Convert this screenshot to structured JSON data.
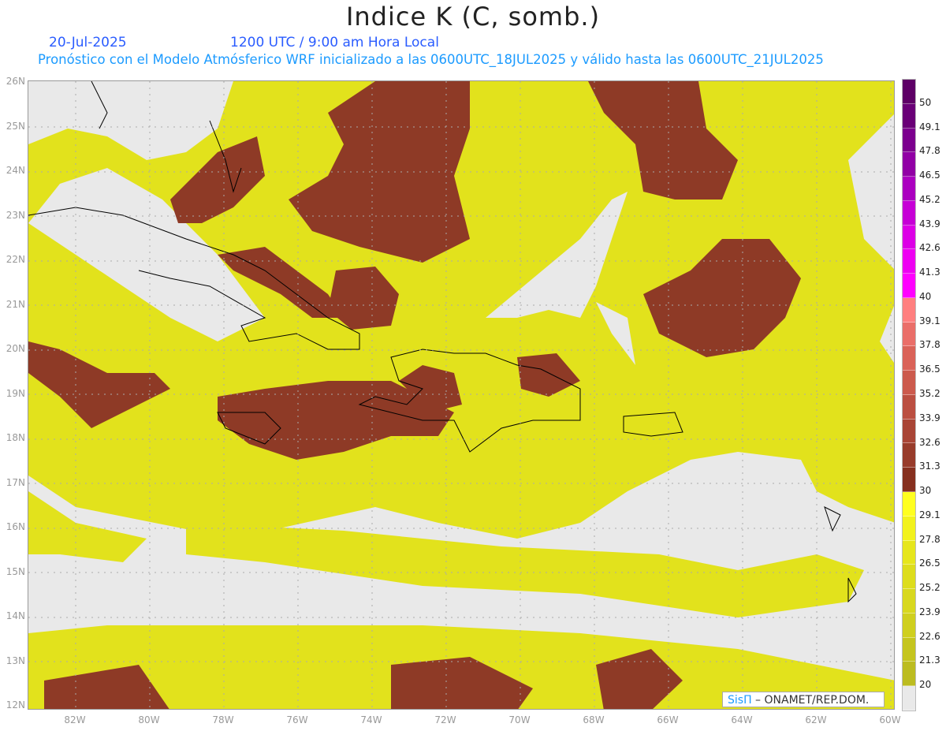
{
  "header": {
    "title": "Indice K (C, somb.)",
    "date": "20-Jul-2025",
    "time": "1200 UTC / 9:00 am Hora Local",
    "subtitle": "Pronóstico con el Modelo Atmósferico WRF inicializado a las 0600UTC_18JUL2025 y válido hasta las  0600UTC_21JUL2025"
  },
  "lat_labels": [
    "26N",
    "25N",
    "24N",
    "23N",
    "22N",
    "21N",
    "20N",
    "19N",
    "18N",
    "17N",
    "16N",
    "15N",
    "14N",
    "13N",
    "12N"
  ],
  "lon_labels": [
    "82W",
    "80W",
    "78W",
    "76W",
    "74W",
    "72W",
    "70W",
    "68W",
    "66W",
    "64W",
    "62W",
    "60W"
  ],
  "colorbar": {
    "labels": [
      "50",
      "49.1",
      "47.8",
      "46.5",
      "45.2",
      "43.9",
      "42.6",
      "41.3",
      "40",
      "39.1",
      "37.8",
      "36.5",
      "35.2",
      "33.9",
      "32.6",
      "31.3",
      "30",
      "29.1",
      "27.8",
      "26.5",
      "25.2",
      "23.9",
      "22.6",
      "21.3",
      "20"
    ],
    "colors": [
      "#5e0066",
      "#6a0077",
      "#7c008e",
      "#9100a5",
      "#ab00c0",
      "#c600d6",
      "#dc00e6",
      "#ee00f2",
      "#ff00ff",
      "#ff7f7f",
      "#ea6e69",
      "#da6258",
      "#cc5a4d",
      "#bb4f41",
      "#a94536",
      "#983c2b",
      "#86301f",
      "#ffff20",
      "#f2f21c",
      "#e6e61c",
      "#dddd1c",
      "#d8d81e",
      "#cfcf1e",
      "#c5c51e",
      "#bcbc20",
      "#e9e9e9"
    ]
  },
  "credit": {
    "brand": "SisΠ",
    "text": " –  ONAMET/REP.DOM."
  }
}
